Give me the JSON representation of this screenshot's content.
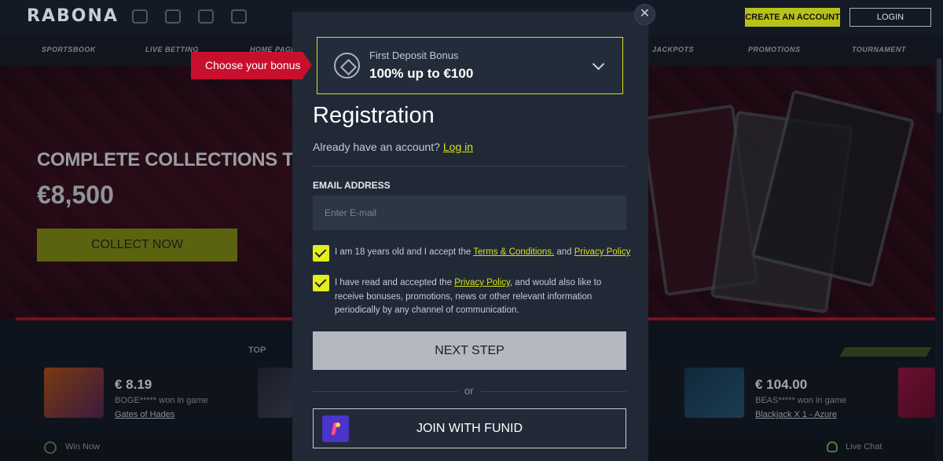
{
  "site": {
    "logo": "RABONA",
    "header_icons": [
      "calendar-icon",
      "trophy-icon",
      "refresh-icon",
      "diamond-icon"
    ],
    "create_account": "CREATE AN ACCOUNT",
    "login": "LOGIN",
    "nav": [
      "SPORTSBOOK",
      "LIVE BETTING",
      "HOME PAGE",
      "JACKPOTS",
      "PROMOTIONS",
      "TOURNAMENT"
    ],
    "hero": {
      "title": "COMPLETE COLLECTIONS TO CLA",
      "amount": "€8,500",
      "button": "COLLECT NOW"
    },
    "top_label": "TOP",
    "ticker": [
      {
        "amount": "€ 8.19",
        "who": "BOGE***** won in game",
        "game": "Gates of Hades"
      },
      {
        "amount": "€ 104.00",
        "who": "BEAS***** won in game",
        "game": "Blackjack X 1 - Azure"
      }
    ],
    "win_now": "Win Now",
    "live_chat": "Live Chat"
  },
  "modal": {
    "close_icon": "close-icon",
    "choose_bonus": "Choose your bonus",
    "bonus": {
      "label": "First Deposit Bonus",
      "value": "100% up to €100"
    },
    "title": "Registration",
    "already": "Already have an account?",
    "login_link": "Log in",
    "email_label": "EMAIL ADDRESS",
    "email_placeholder": "Enter E-mail",
    "consent1": {
      "prefix": "I am 18 years old and I accept the",
      "terms": "Terms & Conditions.",
      "and": "and",
      "privacy": "Privacy Policy"
    },
    "consent2": {
      "prefix": "I have read and accepted the",
      "privacy": "Privacy Policy",
      "suffix": ", and would also like to receive bonuses, promotions, news or other relevant information periodically by any channel of communication."
    },
    "next_step": "NEXT STEP",
    "or": "or",
    "funid": "JOIN WITH FUNID"
  },
  "colors": {
    "accent": "#d6e11a",
    "tag_red": "#c8102e",
    "modal_bg": "#212937"
  }
}
